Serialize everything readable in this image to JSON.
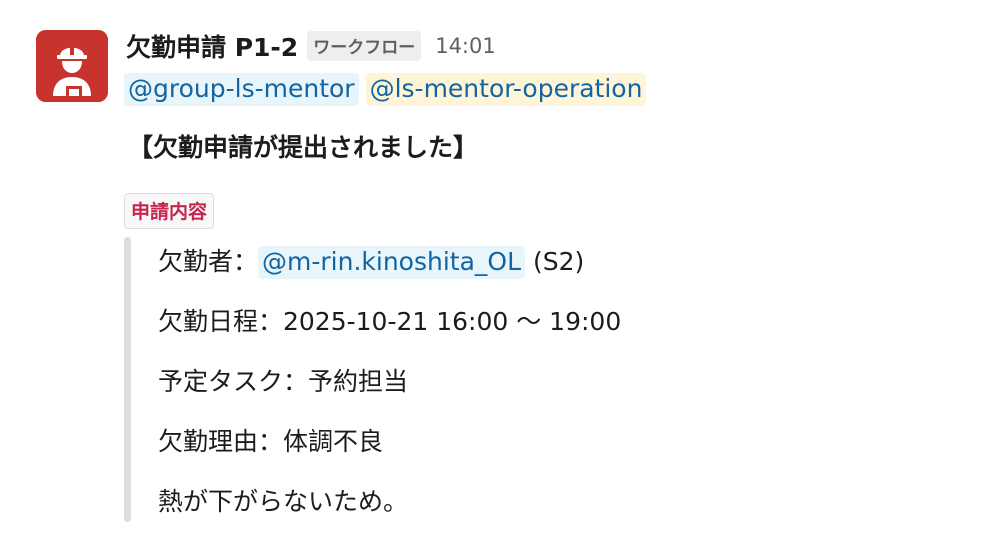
{
  "sender": {
    "name": "欠勤申請 P1-2",
    "app_badge": "ワークフロー",
    "time": "14:01"
  },
  "mentions": [
    "@group-ls-mentor",
    "@ls-mentor-operation"
  ],
  "title": "【欠勤申請が提出されました】",
  "section_label": "申請内容",
  "details": {
    "absentee_label": "欠勤者：",
    "absentee_mention": "@m-rin.kinoshita_OL",
    "absentee_suffix": " (S2)",
    "schedule": "欠勤日程：2025-10-21 16:00 〜 19:00",
    "task": "予定タスク：予約担当",
    "reason": "欠勤理由：体調不良",
    "note": "熱が下がらないため。"
  },
  "colors": {
    "avatar_bg": "#c8332d",
    "mention_text": "#1264a3",
    "user_mention_bg": "#e8f5fa",
    "group_mention_bg": "#fef5d9",
    "section_label_text": "#c7254e",
    "quote_bar": "#dddddd"
  },
  "icons": {
    "avatar": "worker-avatar-icon"
  }
}
